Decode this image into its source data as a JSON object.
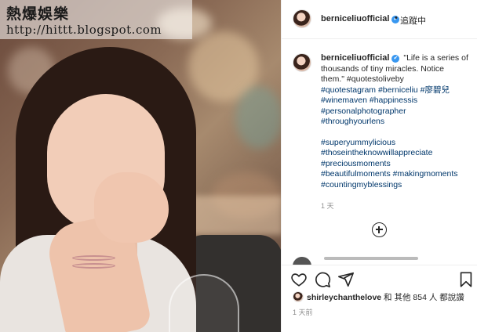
{
  "watermark": {
    "title": "熱爆娛樂",
    "url": "http://hittt.blogspot.com"
  },
  "post_header": {
    "username": "berniceliuofficial",
    "verified_mark": "✔",
    "separator": "•",
    "follow_status": "追蹤中"
  },
  "caption": {
    "username": "berniceliuofficial",
    "lines": [
      "\"Life is a series of",
      "thousands of tiny miracles. Notice",
      "them.\" #quotestoliveby",
      "#quotestagram #berniceliu #廖碧兒",
      "#winemaven #happinessis",
      "#personalphotographer",
      "#throughyourlens"
    ],
    "hashtags_block": [
      "#superyummylicious",
      "#thoseintheknowwillappreciate",
      "#preciousmoments",
      "#beautifulmoments #makingmoments",
      "#countingmyblessings"
    ],
    "age": "1 天"
  },
  "load_more": {
    "icon": "plus-circle-icon"
  },
  "actions": {
    "like_icon": "heart-icon",
    "comment_icon": "comment-icon",
    "share_icon": "send-icon",
    "save_icon": "bookmark-icon"
  },
  "likes": {
    "user": "shirleychanthelove",
    "joiner": "和 其他",
    "count": "854",
    "suffix": "人 都說讚"
  },
  "timestamp": "1 天前"
}
